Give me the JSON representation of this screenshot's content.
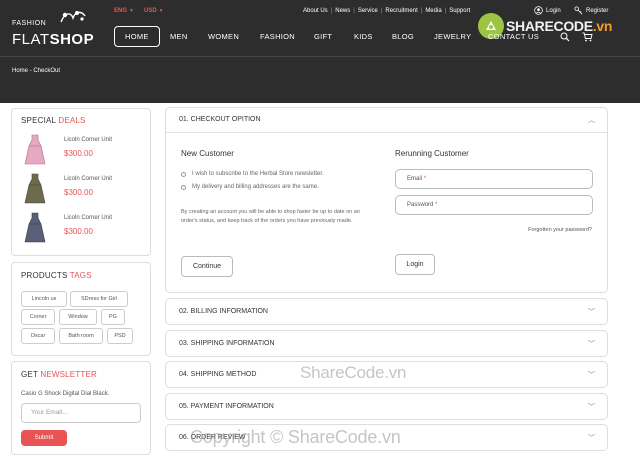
{
  "header": {
    "logo_small": "FASHION",
    "logo_light": "FLAT",
    "logo_bold": "SHOP",
    "lang": "ENG",
    "currency": "USD",
    "top_links": [
      "About Us",
      "News",
      "Service",
      "Recruitment",
      "Media",
      "Support"
    ],
    "login_label": "Login",
    "register_label": "Register",
    "nav": [
      "HOME",
      "MEN",
      "WOMEN",
      "FASHION",
      "GIFT",
      "KIDS",
      "BLOG",
      "JEWELRY",
      "CONTACT US"
    ],
    "breadcrumb": "Home - CheckOut"
  },
  "watermark": {
    "brand_main": "SHARE",
    "brand_accent": "CODE",
    "brand_tld": ".vn",
    "mid": "ShareCode.vn",
    "bottom": "Copyright © ShareCode.vn"
  },
  "sidebar": {
    "deals_title": "SPECIAL",
    "deals_accent": "DEALS",
    "deals": [
      {
        "name": "Licoln Corner Unit",
        "price": "$300.00",
        "color": "#e7a8c2"
      },
      {
        "name": "Licoln Corner Unit",
        "price": "$300.00",
        "color": "#6e6a4e"
      },
      {
        "name": "Licoln Corner Unit",
        "price": "$300.00",
        "color": "#5a5f78"
      }
    ],
    "tags_title": "PRODUCTS",
    "tags_accent": "TAGS",
    "tags": [
      "Lincoln us",
      "SDress for Girl",
      "Corner",
      "Window",
      "PG",
      "Oscar",
      "Bath room",
      "PSD"
    ],
    "newsletter_title": "GET",
    "newsletter_accent": "NEWSLETTER",
    "newsletter_text": "Casio G Shock Digital Dial Black.",
    "newsletter_placeholder": "Your Email...",
    "newsletter_button": "Submit"
  },
  "checkout": {
    "step1_title": "01. CHECKOUT OPITION",
    "new_customer": {
      "title": "New Customer",
      "options": [
        "I wish to subscribe to the Herbal Store newsletter.",
        "My delivery and billing addresses are the same."
      ],
      "paragraph": "By creating an account you will be able to shop faster be up to date on an order's status, and keep track of the orders you have previously made.",
      "button": "Continue"
    },
    "returning_customer": {
      "title": "Rerunning Customer",
      "email_label": "Email",
      "password_label": "Password",
      "required_mark": "*",
      "forgot": "Forgotten your password?",
      "button": "Login"
    },
    "steps": [
      "02. BILLING INFORMATION",
      "03. SHIPPING INFORMATION",
      "04. SHIPPING METHOD",
      "05. PAYMENT INFORMATION",
      "06. ORDER REVIEW"
    ]
  },
  "colors": {
    "accent": "#e95353",
    "header_bg": "#2d2d2d"
  }
}
